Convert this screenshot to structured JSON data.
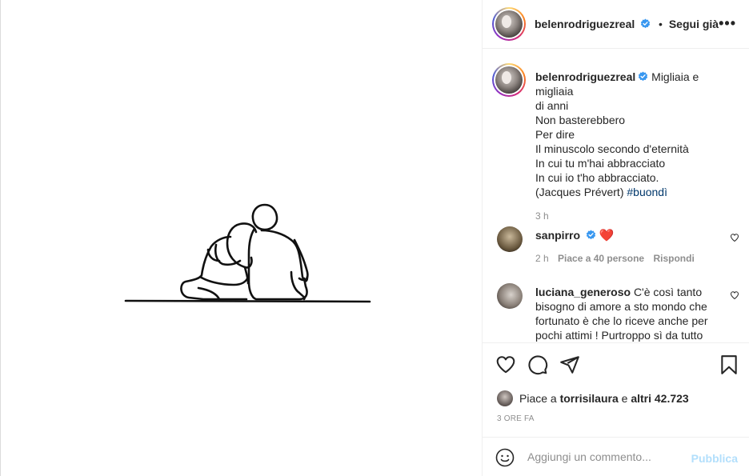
{
  "post": {
    "author": "belenrodriguezreal",
    "follow_separator": "•",
    "follow_label": "Segui già",
    "more_label": "•••"
  },
  "caption": {
    "author": "belenrodriguezreal",
    "lines": [
      "Migliaia e migliaia",
      "di anni",
      "Non basterebbero",
      "Per dire",
      "Il minuscolo secondo d'eternità",
      "In cui tu m'hai abbracciato",
      "In cui io t'ho abbracciato.",
      "(Jacques Prévert)"
    ],
    "hashtag": "#buondì",
    "time": "3 h"
  },
  "comments": [
    {
      "author": "sanpirro",
      "verified": true,
      "text": "❤️",
      "time": "2 h",
      "likes": "Piace a 40 persone",
      "reply": "Rispondi"
    },
    {
      "author": "luciana_generoso",
      "verified": false,
      "lines": [
        "C'è così tanto",
        "bisogno di amore a sto mondo che",
        "fortunato è che lo riceve anche per",
        "pochi attimi ! Purtroppo sì da tutto"
      ]
    }
  ],
  "likes": {
    "prefix": "Piace a",
    "user": "torrisilaura",
    "connector": "e",
    "others": "altri 42.723"
  },
  "timestamp": "3 ORE FA",
  "composer": {
    "placeholder": "Aggiungi un commento...",
    "publish_label": "Pubblica"
  },
  "icons": {
    "verified": "verified-badge-icon",
    "like": "heart-icon",
    "comment": "comment-icon",
    "share": "paper-plane-icon",
    "save": "bookmark-icon",
    "emoji": "emoji-icon"
  },
  "colors": {
    "verified": "#3897f0",
    "hashtag": "#00376b",
    "publish_disabled": "#b2dffc",
    "muted": "#8e8e8e",
    "heart_red": "#ed4956"
  }
}
